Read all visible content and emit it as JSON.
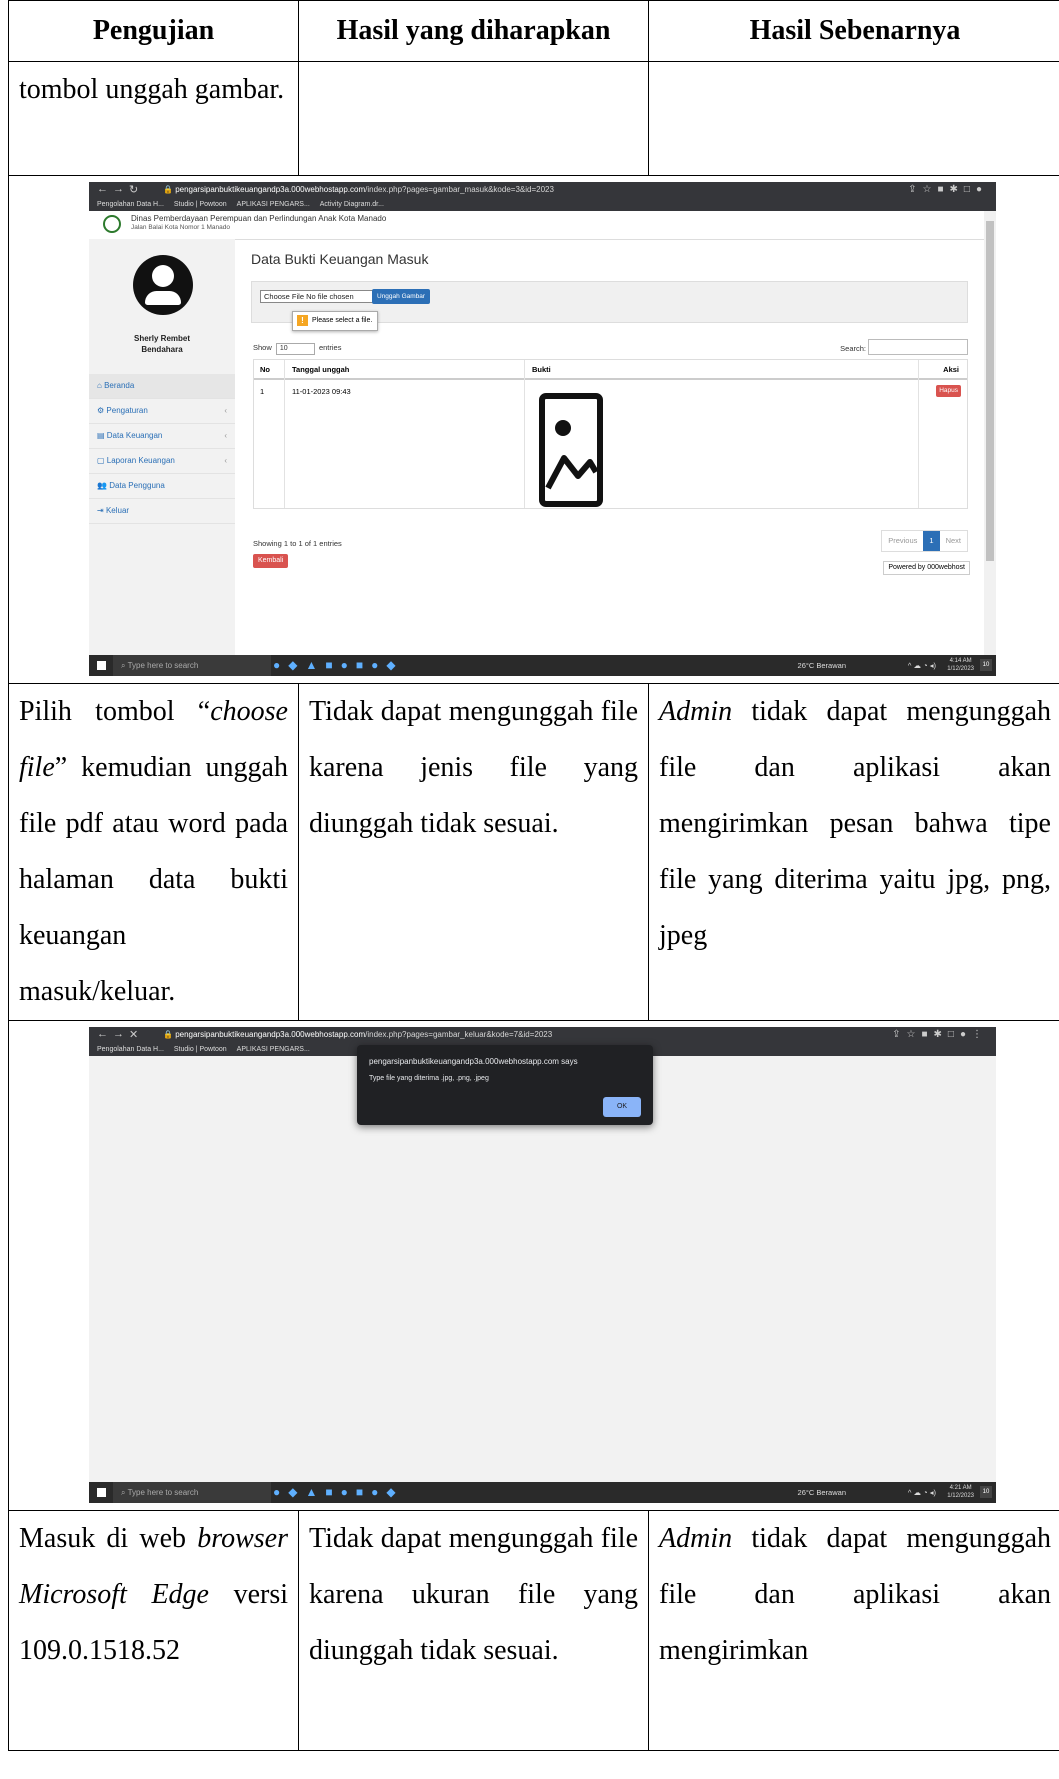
{
  "table": {
    "headers": [
      "Pengujian",
      "Hasil yang diharapkan",
      "Hasil Sebenarnya"
    ],
    "row1": {
      "c1": "tombol unggah gambar.",
      "c2": "",
      "c3": ""
    },
    "row2": {
      "c1_a": "Pilih tombol “",
      "c1_b": "choose file",
      "c1_c": "” kemudian unggah file pdf atau word pada halaman data bukti keuangan masuk/keluar.",
      "c2": "Tidak dapat mengunggah file karena jenis file yang diunggah tidak sesuai.",
      "c3_a": "Admin",
      "c3_b": " tidak dapat mengunggah file dan aplikasi akan mengirimkan pesan bahwa tipe file yang diterima yaitu jpg, png, jpeg"
    },
    "row3": {
      "c1_a": "Masuk di web ",
      "c1_b": "browser Microsoft Edge",
      "c1_c": " versi 109.0.1518.52",
      "c2": "Tidak dapat mengunggah file karena ukuran file yang diunggah tidak sesuai.",
      "c3_a": "Admin",
      "c3_b": " tidak dapat mengunggah file dan aplikasi akan mengirimkan"
    }
  },
  "screenshot1": {
    "url_host": "pengarsipanbuktikeuangandp3a.000webhostapp.com",
    "url_path": "/index.php?pages=gambar_masuk&kode=3&id=2023",
    "bookmarks": [
      "Pengolahan Data H...",
      "Studio | Powtoon",
      "APLIKASI PENGARS...",
      "Activity Diagram.dr..."
    ],
    "site_title": "Dinas Pemberdayaan Perempuan dan Perlindungan Anak Kota Manado",
    "site_address": "Jalan Balai Kota Nomor 1 Manado",
    "user_name": "Sherly Rembet",
    "user_role": "Bendahara",
    "menu": [
      "Beranda",
      "Pengaturan",
      "Data Keuangan",
      "Laporan Keuangan",
      "Data Pengguna",
      "Keluar"
    ],
    "page_title": "Data Bukti Keuangan Masuk",
    "choose_file": "Choose File  No file chosen",
    "upload_btn": "Unggah Gambar",
    "tooltip": "Please select a file.",
    "show_label": "Show",
    "show_value": "10",
    "entries_label": "entries",
    "search_label": "Search:",
    "col_no": "No",
    "col_date": "Tanggal unggah",
    "col_proof": "Bukti",
    "col_action": "Aksi",
    "row_no": "1",
    "row_date": "11-01-2023 09:43",
    "delete_btn": "Hapus",
    "showing": "Showing 1 to 1 of 1 entries",
    "prev": "Previous",
    "page": "1",
    "next": "Next",
    "back_btn": "Kembali",
    "powered": "Powered by 000webhost",
    "taskbar_search": "Type here to search",
    "weather": "26°C  Berawan",
    "time": "4:14 AM",
    "date": "1/12/2023"
  },
  "screenshot2": {
    "url_host": "pengarsipanbuktikeuangandp3a.000webhostapp.com",
    "url_path": "/index.php?pages=gambar_keluar&kode=7&id=2023",
    "bookmarks": [
      "Pengolahan Data H...",
      "Studio | Powtoon",
      "APLIKASI PENGARS..."
    ],
    "dialog_title": "pengarsipanbuktikeuangandp3a.000webhostapp.com says",
    "dialog_msg": "Type file yang diterima .jpg, .png, .jpeg",
    "ok": "OK",
    "taskbar_search": "Type here to search",
    "weather": "26°C  Berawan",
    "time": "4:21 AM",
    "date": "1/12/2023"
  }
}
